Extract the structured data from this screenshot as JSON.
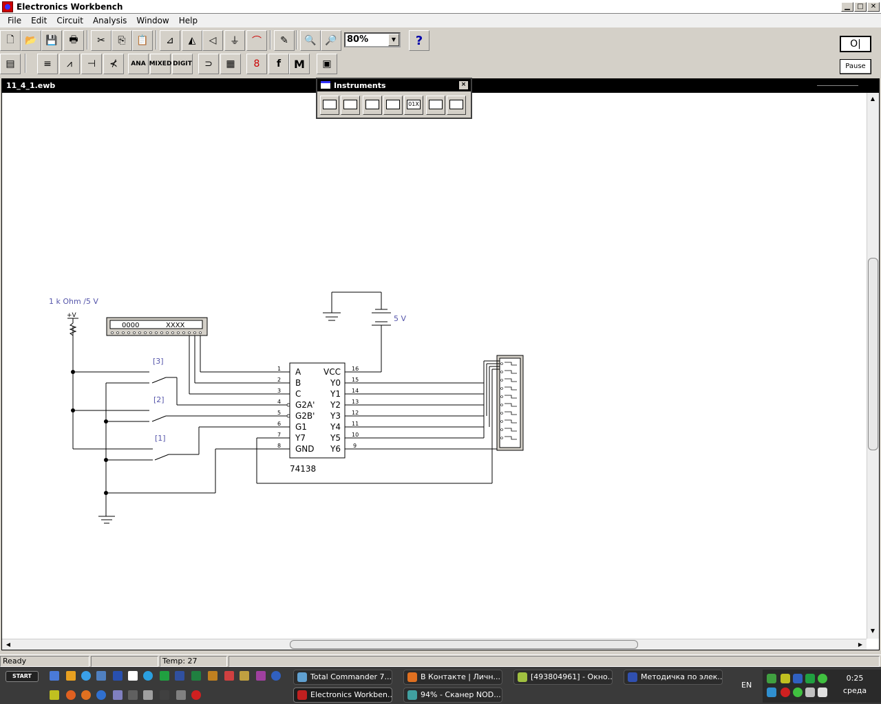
{
  "app": {
    "title": "Electronics Workbench"
  },
  "menu": [
    "File",
    "Edit",
    "Circuit",
    "Analysis",
    "Window",
    "Help"
  ],
  "toolbar": {
    "zoom_value": "80%",
    "help_label": "?",
    "pause_label": "Pause",
    "power_label": "O|",
    "parts_labels": {
      "ana": "ANA",
      "mixed": "MIXED",
      "digit": "DIGIT",
      "macro": "M",
      "func": "f"
    }
  },
  "document": {
    "title": "11_4_1.ewb"
  },
  "instruments": {
    "title": "Instruments",
    "close": "×",
    "binary_label": "01X"
  },
  "circuit": {
    "switch_labels": [
      "[3]",
      "[2]",
      "[1]"
    ],
    "pullup_label": "1 k Ohm /5 V",
    "vcc_symbol": "+V",
    "battery_label": "5 V",
    "word_generator": {
      "left": "0000",
      "right": "XXXX"
    },
    "chip_name": "74138",
    "chip_left_pins": [
      {
        "num": "1",
        "name": "A"
      },
      {
        "num": "2",
        "name": "B"
      },
      {
        "num": "3",
        "name": "C"
      },
      {
        "num": "4",
        "name": "G2A'"
      },
      {
        "num": "5",
        "name": "G2B'"
      },
      {
        "num": "6",
        "name": "G1"
      },
      {
        "num": "7",
        "name": "Y7"
      },
      {
        "num": "8",
        "name": "GND"
      }
    ],
    "chip_right_pins": [
      {
        "num": "16",
        "name": "VCC"
      },
      {
        "num": "15",
        "name": "Y0"
      },
      {
        "num": "14",
        "name": "Y1"
      },
      {
        "num": "13",
        "name": "Y2"
      },
      {
        "num": "12",
        "name": "Y3"
      },
      {
        "num": "11",
        "name": "Y4"
      },
      {
        "num": "10",
        "name": "Y5"
      },
      {
        "num": "9",
        "name": "Y6"
      }
    ]
  },
  "status": {
    "ready": "Ready",
    "temp": "Temp: 27"
  },
  "taskbar": {
    "start": "START",
    "tasks": [
      "Total Commander 7....",
      "В Контакте | Личн...",
      "[493804961] - Окно...",
      "Методичка по элек...",
      "Electronics Workben...",
      "94% - Сканер NOD..."
    ],
    "lang": "EN",
    "time": "0:25",
    "day": "среда"
  }
}
